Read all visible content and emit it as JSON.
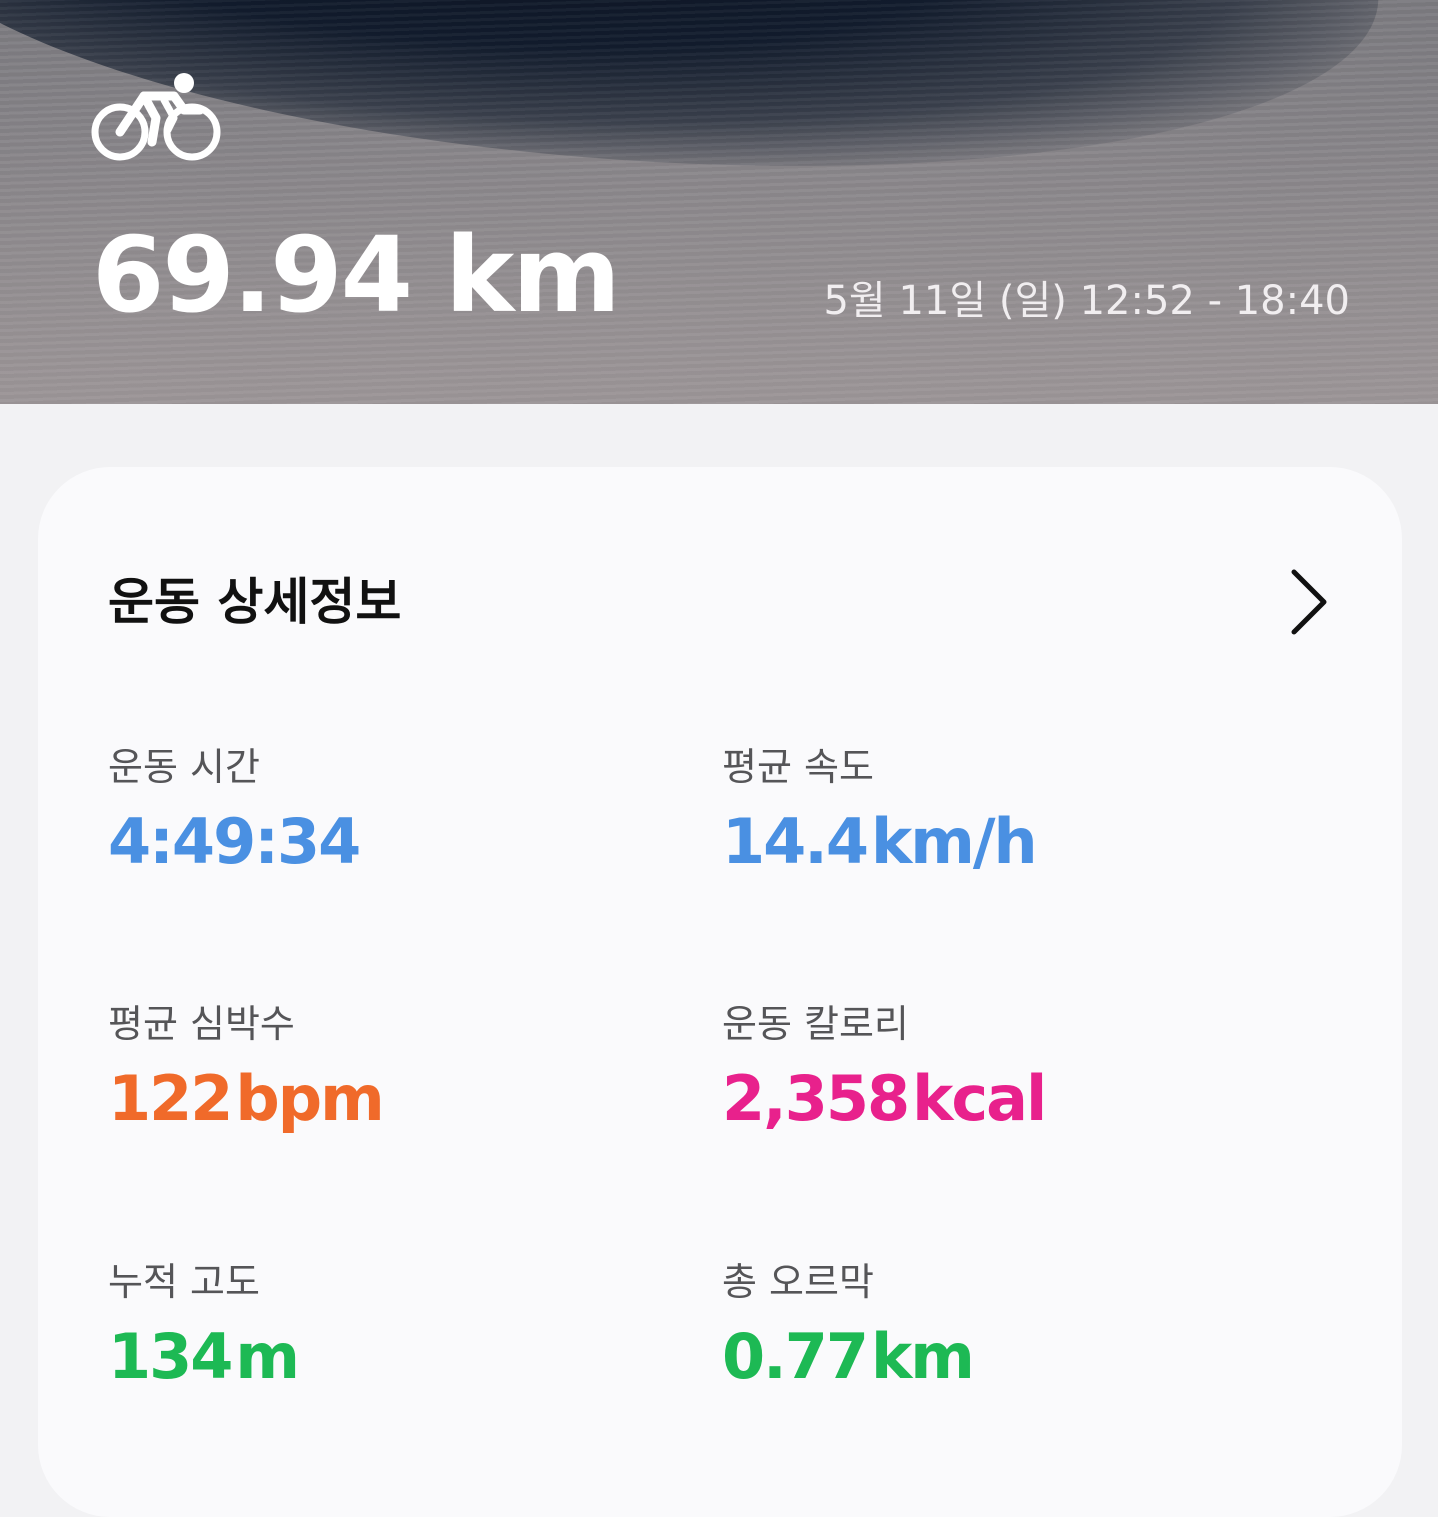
{
  "header": {
    "activity_icon": "cycling-icon",
    "distance": "69.94 km",
    "datetime": "5월 11일 (일) 12:52 - 18:40"
  },
  "details": {
    "title": "운동 상세정보",
    "chevron_icon": "chevron-right-icon",
    "stats": [
      {
        "label": "운동 시간",
        "value": "4:49:34",
        "unit": "",
        "color": "#4a90e2"
      },
      {
        "label": "평균 속도",
        "value": "14.4",
        "unit": "km/h",
        "color": "#4a90e2"
      },
      {
        "label": "평균 심박수",
        "value": "122",
        "unit": "bpm",
        "color": "#f06a2a"
      },
      {
        "label": "운동 칼로리",
        "value": "2,358",
        "unit": "kcal",
        "color": "#e8218c"
      },
      {
        "label": "누적 고도",
        "value": "134",
        "unit": "m",
        "color": "#1db954"
      },
      {
        "label": "총 오르막",
        "value": "0.77",
        "unit": "km",
        "color": "#1db954"
      }
    ]
  }
}
